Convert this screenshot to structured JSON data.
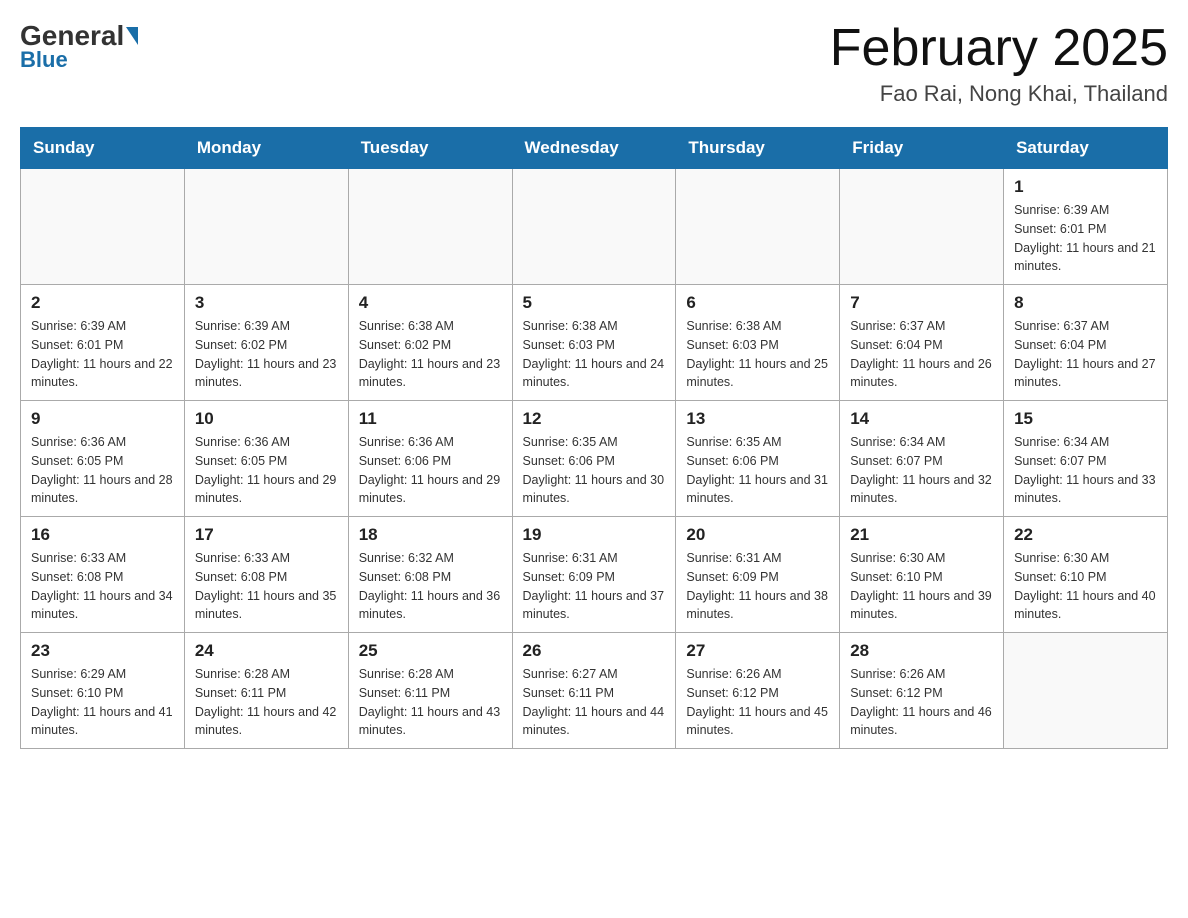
{
  "header": {
    "logo_general": "General",
    "logo_blue": "Blue",
    "title": "February 2025",
    "subtitle": "Fao Rai, Nong Khai, Thailand"
  },
  "days_of_week": [
    "Sunday",
    "Monday",
    "Tuesday",
    "Wednesday",
    "Thursday",
    "Friday",
    "Saturday"
  ],
  "weeks": [
    [
      {
        "day": "",
        "sunrise": "",
        "sunset": "",
        "daylight": ""
      },
      {
        "day": "",
        "sunrise": "",
        "sunset": "",
        "daylight": ""
      },
      {
        "day": "",
        "sunrise": "",
        "sunset": "",
        "daylight": ""
      },
      {
        "day": "",
        "sunrise": "",
        "sunset": "",
        "daylight": ""
      },
      {
        "day": "",
        "sunrise": "",
        "sunset": "",
        "daylight": ""
      },
      {
        "day": "",
        "sunrise": "",
        "sunset": "",
        "daylight": ""
      },
      {
        "day": "1",
        "sunrise": "Sunrise: 6:39 AM",
        "sunset": "Sunset: 6:01 PM",
        "daylight": "Daylight: 11 hours and 21 minutes."
      }
    ],
    [
      {
        "day": "2",
        "sunrise": "Sunrise: 6:39 AM",
        "sunset": "Sunset: 6:01 PM",
        "daylight": "Daylight: 11 hours and 22 minutes."
      },
      {
        "day": "3",
        "sunrise": "Sunrise: 6:39 AM",
        "sunset": "Sunset: 6:02 PM",
        "daylight": "Daylight: 11 hours and 23 minutes."
      },
      {
        "day": "4",
        "sunrise": "Sunrise: 6:38 AM",
        "sunset": "Sunset: 6:02 PM",
        "daylight": "Daylight: 11 hours and 23 minutes."
      },
      {
        "day": "5",
        "sunrise": "Sunrise: 6:38 AM",
        "sunset": "Sunset: 6:03 PM",
        "daylight": "Daylight: 11 hours and 24 minutes."
      },
      {
        "day": "6",
        "sunrise": "Sunrise: 6:38 AM",
        "sunset": "Sunset: 6:03 PM",
        "daylight": "Daylight: 11 hours and 25 minutes."
      },
      {
        "day": "7",
        "sunrise": "Sunrise: 6:37 AM",
        "sunset": "Sunset: 6:04 PM",
        "daylight": "Daylight: 11 hours and 26 minutes."
      },
      {
        "day": "8",
        "sunrise": "Sunrise: 6:37 AM",
        "sunset": "Sunset: 6:04 PM",
        "daylight": "Daylight: 11 hours and 27 minutes."
      }
    ],
    [
      {
        "day": "9",
        "sunrise": "Sunrise: 6:36 AM",
        "sunset": "Sunset: 6:05 PM",
        "daylight": "Daylight: 11 hours and 28 minutes."
      },
      {
        "day": "10",
        "sunrise": "Sunrise: 6:36 AM",
        "sunset": "Sunset: 6:05 PM",
        "daylight": "Daylight: 11 hours and 29 minutes."
      },
      {
        "day": "11",
        "sunrise": "Sunrise: 6:36 AM",
        "sunset": "Sunset: 6:06 PM",
        "daylight": "Daylight: 11 hours and 29 minutes."
      },
      {
        "day": "12",
        "sunrise": "Sunrise: 6:35 AM",
        "sunset": "Sunset: 6:06 PM",
        "daylight": "Daylight: 11 hours and 30 minutes."
      },
      {
        "day": "13",
        "sunrise": "Sunrise: 6:35 AM",
        "sunset": "Sunset: 6:06 PM",
        "daylight": "Daylight: 11 hours and 31 minutes."
      },
      {
        "day": "14",
        "sunrise": "Sunrise: 6:34 AM",
        "sunset": "Sunset: 6:07 PM",
        "daylight": "Daylight: 11 hours and 32 minutes."
      },
      {
        "day": "15",
        "sunrise": "Sunrise: 6:34 AM",
        "sunset": "Sunset: 6:07 PM",
        "daylight": "Daylight: 11 hours and 33 minutes."
      }
    ],
    [
      {
        "day": "16",
        "sunrise": "Sunrise: 6:33 AM",
        "sunset": "Sunset: 6:08 PM",
        "daylight": "Daylight: 11 hours and 34 minutes."
      },
      {
        "day": "17",
        "sunrise": "Sunrise: 6:33 AM",
        "sunset": "Sunset: 6:08 PM",
        "daylight": "Daylight: 11 hours and 35 minutes."
      },
      {
        "day": "18",
        "sunrise": "Sunrise: 6:32 AM",
        "sunset": "Sunset: 6:08 PM",
        "daylight": "Daylight: 11 hours and 36 minutes."
      },
      {
        "day": "19",
        "sunrise": "Sunrise: 6:31 AM",
        "sunset": "Sunset: 6:09 PM",
        "daylight": "Daylight: 11 hours and 37 minutes."
      },
      {
        "day": "20",
        "sunrise": "Sunrise: 6:31 AM",
        "sunset": "Sunset: 6:09 PM",
        "daylight": "Daylight: 11 hours and 38 minutes."
      },
      {
        "day": "21",
        "sunrise": "Sunrise: 6:30 AM",
        "sunset": "Sunset: 6:10 PM",
        "daylight": "Daylight: 11 hours and 39 minutes."
      },
      {
        "day": "22",
        "sunrise": "Sunrise: 6:30 AM",
        "sunset": "Sunset: 6:10 PM",
        "daylight": "Daylight: 11 hours and 40 minutes."
      }
    ],
    [
      {
        "day": "23",
        "sunrise": "Sunrise: 6:29 AM",
        "sunset": "Sunset: 6:10 PM",
        "daylight": "Daylight: 11 hours and 41 minutes."
      },
      {
        "day": "24",
        "sunrise": "Sunrise: 6:28 AM",
        "sunset": "Sunset: 6:11 PM",
        "daylight": "Daylight: 11 hours and 42 minutes."
      },
      {
        "day": "25",
        "sunrise": "Sunrise: 6:28 AM",
        "sunset": "Sunset: 6:11 PM",
        "daylight": "Daylight: 11 hours and 43 minutes."
      },
      {
        "day": "26",
        "sunrise": "Sunrise: 6:27 AM",
        "sunset": "Sunset: 6:11 PM",
        "daylight": "Daylight: 11 hours and 44 minutes."
      },
      {
        "day": "27",
        "sunrise": "Sunrise: 6:26 AM",
        "sunset": "Sunset: 6:12 PM",
        "daylight": "Daylight: 11 hours and 45 minutes."
      },
      {
        "day": "28",
        "sunrise": "Sunrise: 6:26 AM",
        "sunset": "Sunset: 6:12 PM",
        "daylight": "Daylight: 11 hours and 46 minutes."
      },
      {
        "day": "",
        "sunrise": "",
        "sunset": "",
        "daylight": ""
      }
    ]
  ]
}
